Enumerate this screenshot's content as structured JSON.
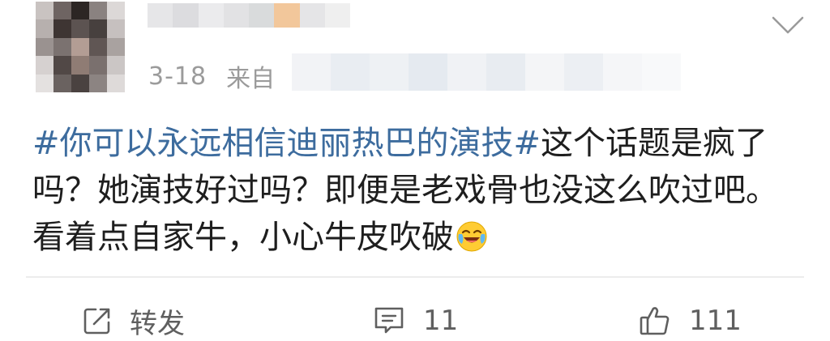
{
  "post": {
    "date": "3-18",
    "source_prefix": "来自",
    "content": {
      "topic": "#你可以永远相信迪丽热巴的演技#",
      "text": "这个话题是疯了吗？她演技好过吗？即便是老戏骨也没这么吹过吧。看着点自家牛，小心牛皮吹破"
    },
    "emoji_icon": "laughing-crying-emoji-icon"
  },
  "actions": {
    "repost_label": "转发",
    "comment_count": "11",
    "like_count": "111"
  },
  "icons": {
    "menu": "chevron-down-icon",
    "repost": "share-edit-icon",
    "comment": "comment-bubble-icon",
    "like": "thumbs-up-icon"
  },
  "colors": {
    "topic": "#3d6c9e",
    "meta": "#9b9b9b",
    "text": "#1e1e1e",
    "action": "#5f5f5f"
  }
}
